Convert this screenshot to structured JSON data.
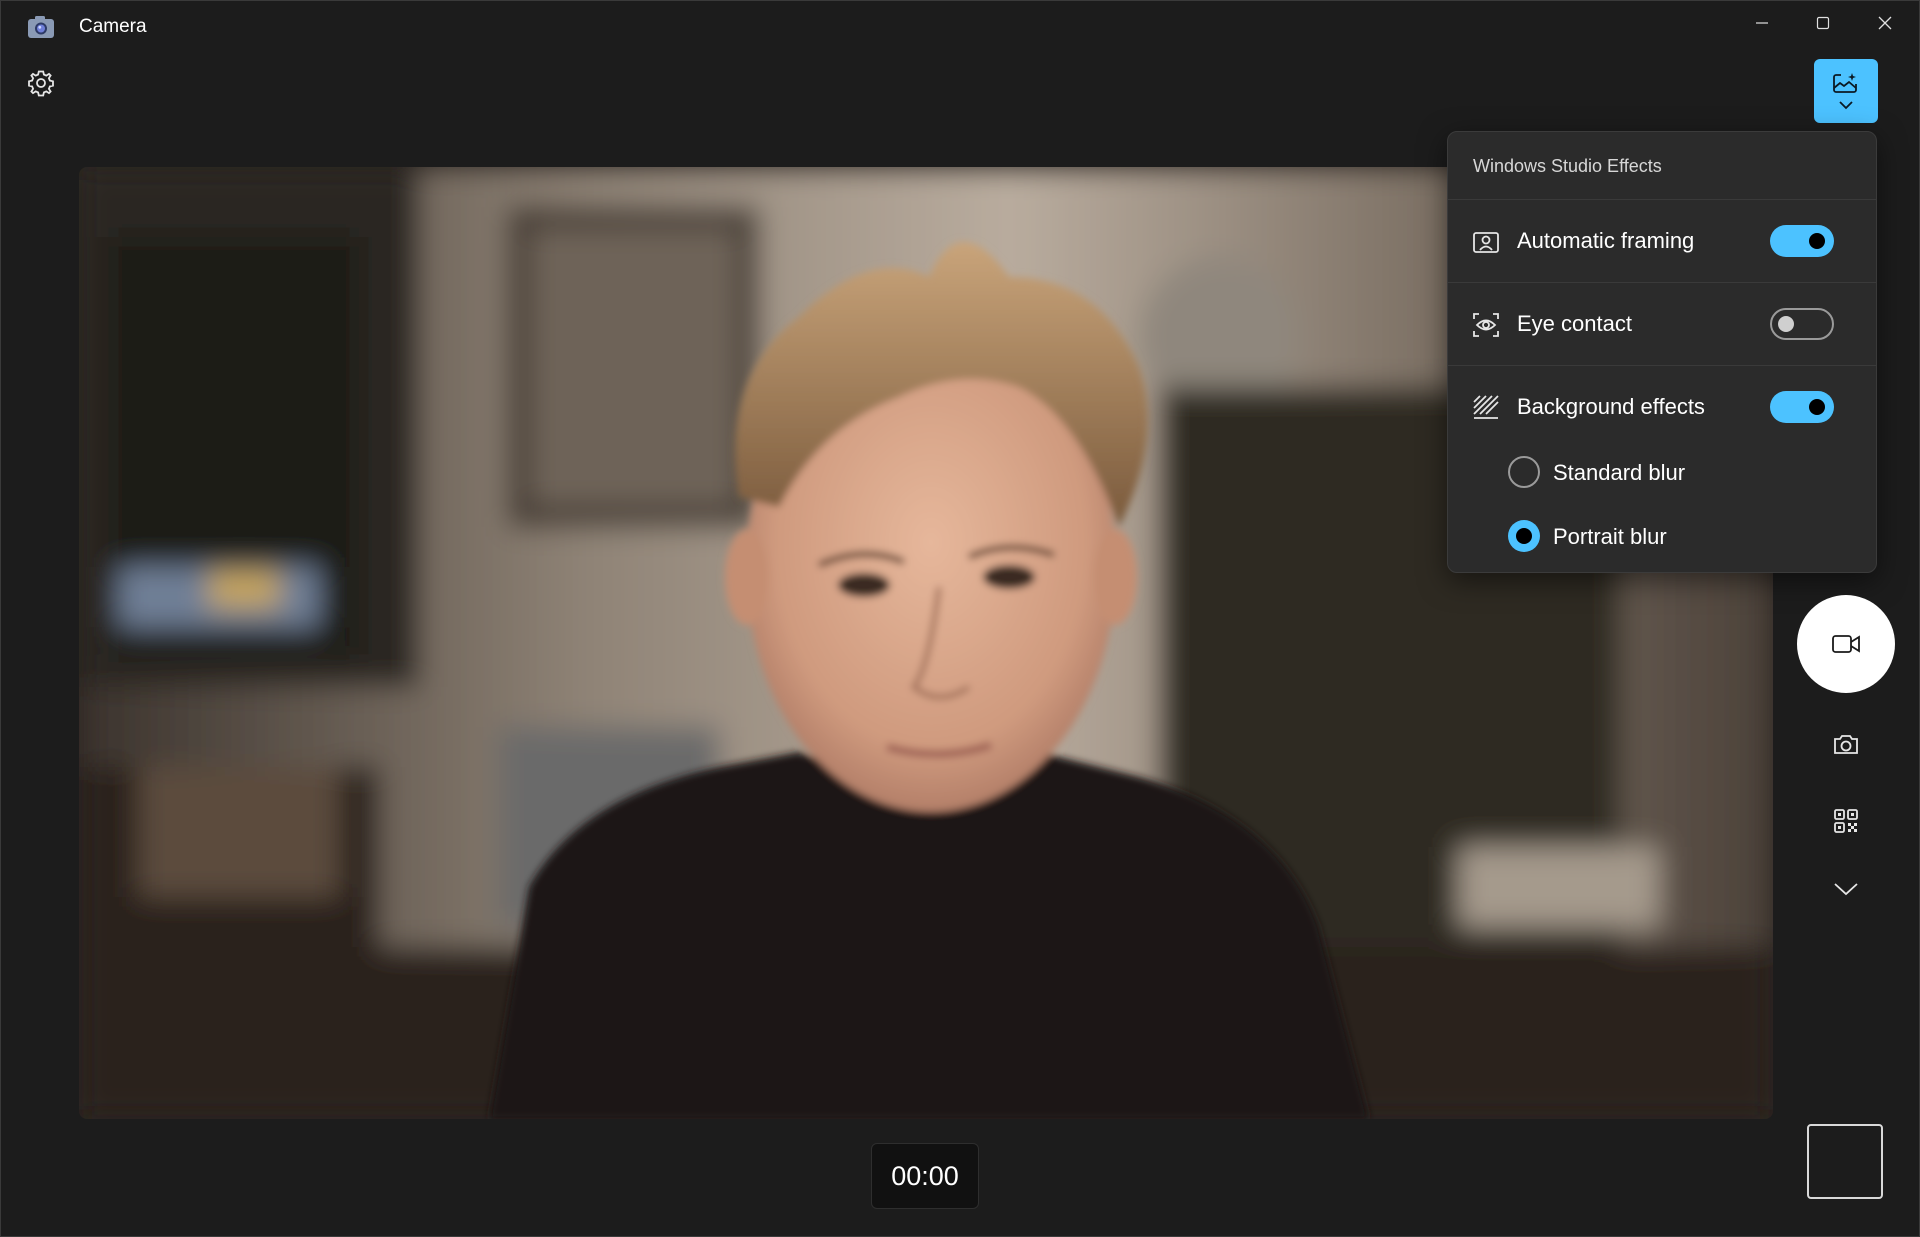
{
  "window": {
    "title": "Camera",
    "controls": [
      "minimize",
      "maximize",
      "close"
    ]
  },
  "toolbar": {
    "settings_icon": "gear-icon",
    "effects_button_icon": "studio-effects-icon",
    "effects_button_color": "#4cc2ff"
  },
  "effects_panel": {
    "title": "Windows Studio Effects",
    "items": [
      {
        "label": "Automatic framing",
        "icon": "framing-icon",
        "enabled": true
      },
      {
        "label": "Eye contact",
        "icon": "eye-contact-icon",
        "enabled": false
      },
      {
        "label": "Background effects",
        "icon": "background-effects-icon",
        "enabled": true
      }
    ],
    "background_options": [
      {
        "label": "Standard blur",
        "selected": false
      },
      {
        "label": "Portrait blur",
        "selected": true
      }
    ]
  },
  "controls": {
    "record_icon": "video-camera-icon",
    "photo_icon": "camera-icon",
    "qr_icon": "qr-code-icon",
    "more_icon": "chevron-down-icon"
  },
  "timer": "00:00",
  "accent_color": "#4cc2ff"
}
